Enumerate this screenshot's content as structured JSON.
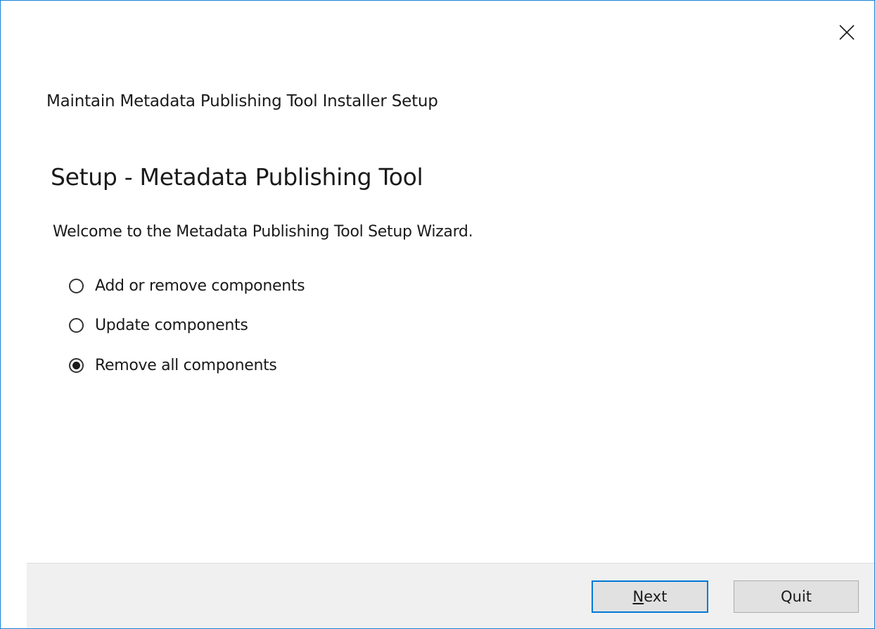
{
  "window": {
    "title": "Maintain Metadata Publishing Tool Installer Setup",
    "close_icon": "close-icon",
    "border_color": "#1883d7"
  },
  "page": {
    "heading": "Setup - Metadata Publishing Tool",
    "welcome": "Welcome to the Metadata Publishing Tool Setup Wizard."
  },
  "options": [
    {
      "label": "Add or remove components",
      "selected": false
    },
    {
      "label": "Update components",
      "selected": false
    },
    {
      "label": "Remove all components",
      "selected": true
    }
  ],
  "buttons": {
    "next": {
      "mnemonic": "N",
      "rest": "ext",
      "focused": true
    },
    "quit": {
      "label": "Quit"
    }
  },
  "colors": {
    "focus_accent": "#0078d7",
    "footer_bg": "#f0f0f0",
    "button_bg": "#e1e1e1"
  }
}
